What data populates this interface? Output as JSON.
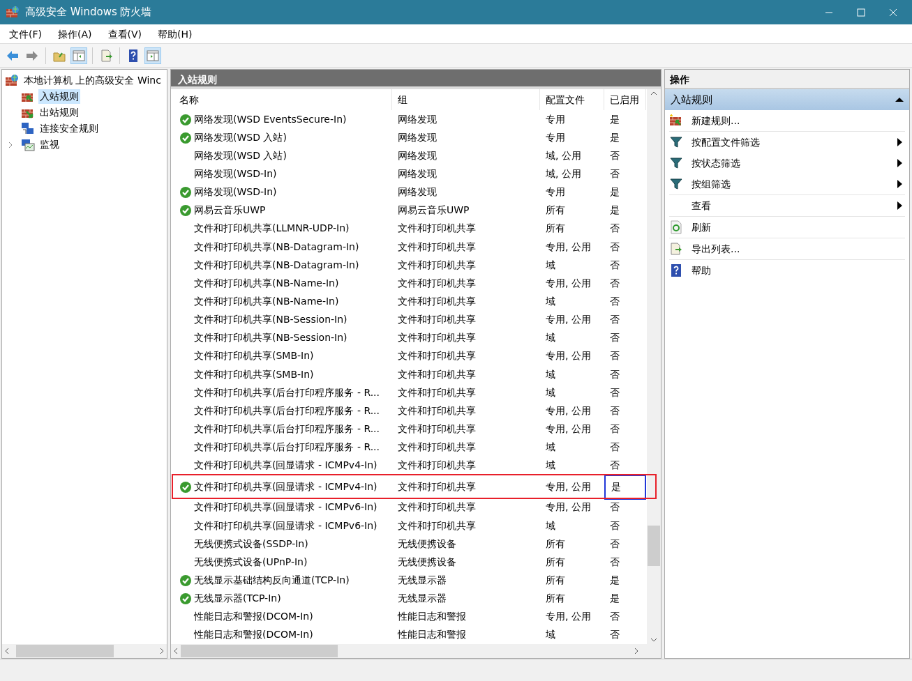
{
  "window": {
    "title": "高级安全 Windows 防火墙"
  },
  "menu": [
    "文件(F)",
    "操作(A)",
    "查看(V)",
    "帮助(H)"
  ],
  "tree": {
    "label": "本地计算机 上的高级安全 Winc",
    "children": [
      {
        "label": "入站规则",
        "selected": true,
        "kind": "inbound"
      },
      {
        "label": "出站规则",
        "selected": false,
        "kind": "outbound"
      },
      {
        "label": "连接安全规则",
        "selected": false,
        "kind": "connection"
      },
      {
        "label": "监视",
        "selected": false,
        "kind": "monitor",
        "expanded": false
      }
    ]
  },
  "center": {
    "title": "入站规则",
    "columns": [
      "名称",
      "组",
      "配置文件",
      "已启用"
    ],
    "rows": [
      {
        "name": "网络发现(WSD EventsSecure-In)",
        "group": "网络发现",
        "profile": "专用",
        "enabled_text": "是",
        "enabled": true,
        "highlighted": false
      },
      {
        "name": "网络发现(WSD 入站)",
        "group": "网络发现",
        "profile": "专用",
        "enabled_text": "是",
        "enabled": true,
        "highlighted": false
      },
      {
        "name": "网络发现(WSD 入站)",
        "group": "网络发现",
        "profile": "域, 公用",
        "enabled_text": "否",
        "enabled": false,
        "highlighted": false
      },
      {
        "name": "网络发现(WSD-In)",
        "group": "网络发现",
        "profile": "域, 公用",
        "enabled_text": "否",
        "enabled": false,
        "highlighted": false
      },
      {
        "name": "网络发现(WSD-In)",
        "group": "网络发现",
        "profile": "专用",
        "enabled_text": "是",
        "enabled": true,
        "highlighted": false
      },
      {
        "name": "网易云音乐UWP",
        "group": "网易云音乐UWP",
        "profile": "所有",
        "enabled_text": "是",
        "enabled": true,
        "highlighted": false
      },
      {
        "name": "文件和打印机共享(LLMNR-UDP-In)",
        "group": "文件和打印机共享",
        "profile": "所有",
        "enabled_text": "否",
        "enabled": false,
        "highlighted": false
      },
      {
        "name": "文件和打印机共享(NB-Datagram-In)",
        "group": "文件和打印机共享",
        "profile": "专用, 公用",
        "enabled_text": "否",
        "enabled": false,
        "highlighted": false
      },
      {
        "name": "文件和打印机共享(NB-Datagram-In)",
        "group": "文件和打印机共享",
        "profile": "域",
        "enabled_text": "否",
        "enabled": false,
        "highlighted": false
      },
      {
        "name": "文件和打印机共享(NB-Name-In)",
        "group": "文件和打印机共享",
        "profile": "专用, 公用",
        "enabled_text": "否",
        "enabled": false,
        "highlighted": false
      },
      {
        "name": "文件和打印机共享(NB-Name-In)",
        "group": "文件和打印机共享",
        "profile": "域",
        "enabled_text": "否",
        "enabled": false,
        "highlighted": false
      },
      {
        "name": "文件和打印机共享(NB-Session-In)",
        "group": "文件和打印机共享",
        "profile": "专用, 公用",
        "enabled_text": "否",
        "enabled": false,
        "highlighted": false
      },
      {
        "name": "文件和打印机共享(NB-Session-In)",
        "group": "文件和打印机共享",
        "profile": "域",
        "enabled_text": "否",
        "enabled": false,
        "highlighted": false
      },
      {
        "name": "文件和打印机共享(SMB-In)",
        "group": "文件和打印机共享",
        "profile": "专用, 公用",
        "enabled_text": "否",
        "enabled": false,
        "highlighted": false
      },
      {
        "name": "文件和打印机共享(SMB-In)",
        "group": "文件和打印机共享",
        "profile": "域",
        "enabled_text": "否",
        "enabled": false,
        "highlighted": false
      },
      {
        "name": "文件和打印机共享(后台打印程序服务 - R...",
        "group": "文件和打印机共享",
        "profile": "域",
        "enabled_text": "否",
        "enabled": false,
        "highlighted": false
      },
      {
        "name": "文件和打印机共享(后台打印程序服务 - R...",
        "group": "文件和打印机共享",
        "profile": "专用, 公用",
        "enabled_text": "否",
        "enabled": false,
        "highlighted": false
      },
      {
        "name": "文件和打印机共享(后台打印程序服务 - R...",
        "group": "文件和打印机共享",
        "profile": "专用, 公用",
        "enabled_text": "否",
        "enabled": false,
        "highlighted": false
      },
      {
        "name": "文件和打印机共享(后台打印程序服务 - R...",
        "group": "文件和打印机共享",
        "profile": "域",
        "enabled_text": "否",
        "enabled": false,
        "highlighted": false
      },
      {
        "name": "文件和打印机共享(回显请求 - ICMPv4-In)",
        "group": "文件和打印机共享",
        "profile": "域",
        "enabled_text": "否",
        "enabled": false,
        "highlighted": false
      },
      {
        "name": "文件和打印机共享(回显请求 - ICMPv4-In)",
        "group": "文件和打印机共享",
        "profile": "专用, 公用",
        "enabled_text": "是",
        "enabled": true,
        "highlighted": true
      },
      {
        "name": "文件和打印机共享(回显请求 - ICMPv6-In)",
        "group": "文件和打印机共享",
        "profile": "专用, 公用",
        "enabled_text": "否",
        "enabled": false,
        "highlighted": false
      },
      {
        "name": "文件和打印机共享(回显请求 - ICMPv6-In)",
        "group": "文件和打印机共享",
        "profile": "域",
        "enabled_text": "否",
        "enabled": false,
        "highlighted": false
      },
      {
        "name": "无线便携式设备(SSDP-In)",
        "group": "无线便携设备",
        "profile": "所有",
        "enabled_text": "否",
        "enabled": false,
        "highlighted": false
      },
      {
        "name": "无线便携式设备(UPnP-In)",
        "group": "无线便携设备",
        "profile": "所有",
        "enabled_text": "否",
        "enabled": false,
        "highlighted": false
      },
      {
        "name": "无线显示基础结构反向通道(TCP-In)",
        "group": "无线显示器",
        "profile": "所有",
        "enabled_text": "是",
        "enabled": true,
        "highlighted": false
      },
      {
        "name": "无线显示器(TCP-In)",
        "group": "无线显示器",
        "profile": "所有",
        "enabled_text": "是",
        "enabled": true,
        "highlighted": false
      },
      {
        "name": "性能日志和警报(DCOM-In)",
        "group": "性能日志和警报",
        "profile": "专用, 公用",
        "enabled_text": "否",
        "enabled": false,
        "highlighted": false
      },
      {
        "name": "性能日志和警报(DCOM-In)",
        "group": "性能日志和警报",
        "profile": "域",
        "enabled_text": "否",
        "enabled": false,
        "highlighted": false
      }
    ]
  },
  "actions": {
    "title": "操作",
    "section": {
      "label": "入站规则",
      "expanded": true
    },
    "items": [
      {
        "label": "新建规则...",
        "kind": "new",
        "submenu": false
      },
      {
        "label": "按配置文件筛选",
        "kind": "filter",
        "submenu": true
      },
      {
        "label": "按状态筛选",
        "kind": "filter",
        "submenu": true
      },
      {
        "label": "按组筛选",
        "kind": "filter",
        "submenu": true
      },
      {
        "label": "查看",
        "kind": "none",
        "submenu": true
      },
      {
        "label": "刷新",
        "kind": "refresh",
        "submenu": false
      },
      {
        "label": "导出列表...",
        "kind": "export",
        "submenu": false
      },
      {
        "label": "帮助",
        "kind": "help",
        "submenu": false
      }
    ]
  }
}
